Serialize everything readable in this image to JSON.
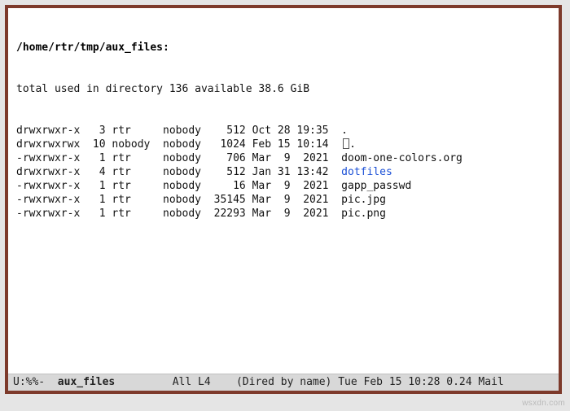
{
  "header": {
    "path": "/home/rtr/tmp/aux_files:",
    "totals": "total used in directory 136 available 38.6 GiB"
  },
  "rows": [
    {
      "perm": "drwxrwxr-x",
      "links": "3",
      "owner": "rtr",
      "group": "nobody",
      "size": "512",
      "date": "Oct 28 19:35",
      "name": ".",
      "class": "fname-plain",
      "cursor": false
    },
    {
      "perm": "drwxrwxrwx",
      "links": "10",
      "owner": "nobody",
      "group": "nobody",
      "size": "1024",
      "date": "Feb 15 10:14",
      "name": ".",
      "class": "fname-plain",
      "cursor": true
    },
    {
      "perm": "-rwxrwxr-x",
      "links": "1",
      "owner": "rtr",
      "group": "nobody",
      "size": "706",
      "date": "Mar  9  2021",
      "name": "doom-one-colors.org",
      "class": "fname-plain",
      "cursor": false
    },
    {
      "perm": "drwxrwxr-x",
      "links": "4",
      "owner": "rtr",
      "group": "nobody",
      "size": "512",
      "date": "Jan 31 13:42",
      "name": "dotfiles",
      "class": "fname-dir",
      "cursor": false
    },
    {
      "perm": "-rwxrwxr-x",
      "links": "1",
      "owner": "rtr",
      "group": "nobody",
      "size": "16",
      "date": "Mar  9  2021",
      "name": "gapp_passwd",
      "class": "fname-link",
      "cursor": false
    },
    {
      "perm": "-rwxrwxr-x",
      "links": "1",
      "owner": "rtr",
      "group": "nobody",
      "size": "35145",
      "date": "Mar  9  2021",
      "name": "pic.jpg",
      "class": "fname-plain",
      "cursor": false
    },
    {
      "perm": "-rwxrwxr-x",
      "links": "1",
      "owner": "rtr",
      "group": "nobody",
      "size": "22293",
      "date": "Mar  9  2021",
      "name": "pic.png",
      "class": "fname-plain",
      "cursor": false
    }
  ],
  "modeline": {
    "left": "U:%%-",
    "buffer": "aux_files",
    "pos": "All L4",
    "mode": "(Dired by name)",
    "time": "Tue Feb 15 10:28",
    "load": "0.24",
    "mail": "Mail"
  },
  "watermark": "wsxdn.com"
}
